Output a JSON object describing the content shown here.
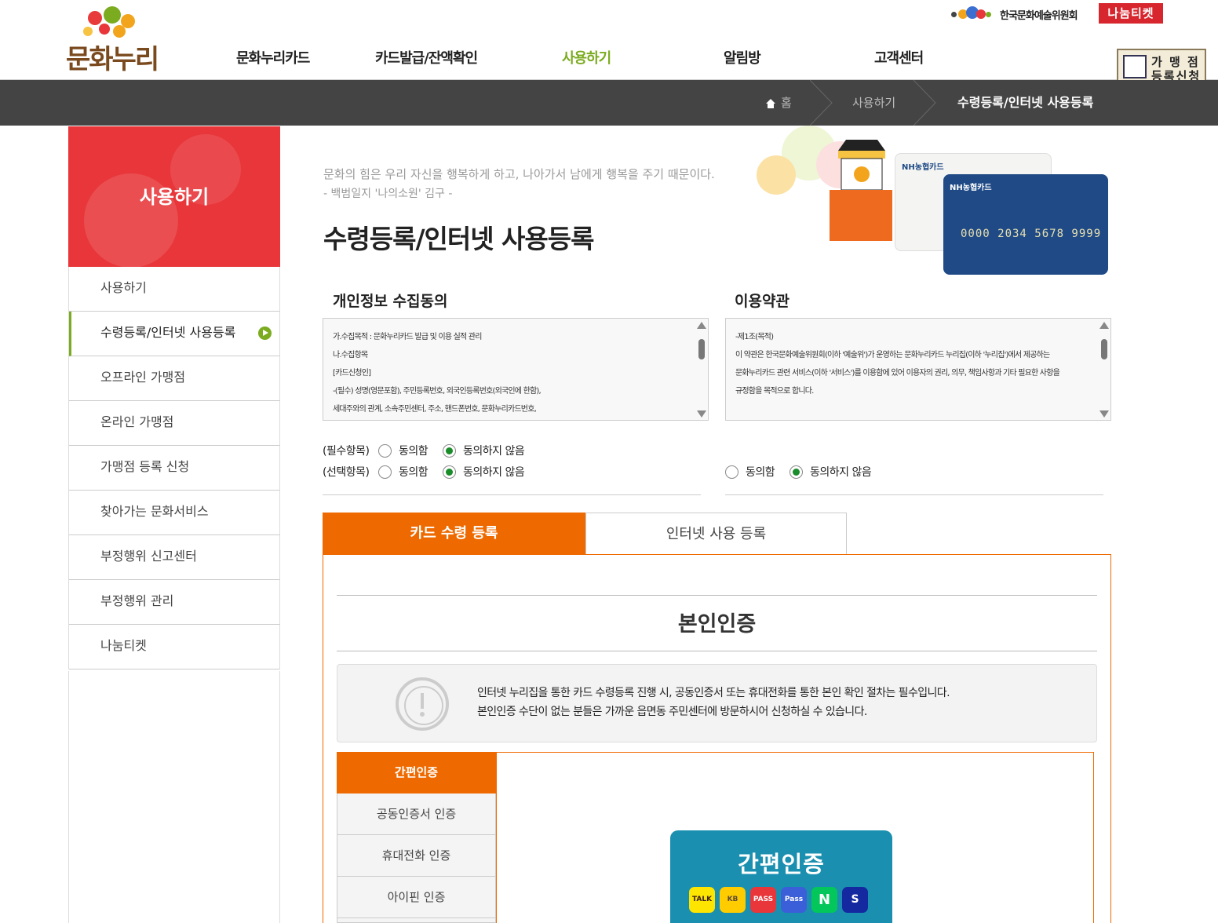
{
  "header": {
    "logo_text": "문화누리",
    "org_name": "한국문화예술위원회",
    "nanum_badge": "나눔티켓",
    "store_apply_line1": "가 맹 점",
    "store_apply_line2": "등록신청",
    "gnb": [
      "문화누리카드",
      "카드발급/잔액확인",
      "사용하기",
      "알림방",
      "고객센터"
    ],
    "gnb_active": "사용하기"
  },
  "breadcrumb": {
    "home": "홈",
    "level1": "사용하기",
    "current": "수령등록/인터넷 사용등록"
  },
  "sidebar": {
    "title": "사용하기",
    "items": [
      {
        "label": "사용하기"
      },
      {
        "label": "수령등록/인터넷 사용등록",
        "active": true
      },
      {
        "label": "오프라인 가맹점"
      },
      {
        "label": "온라인 가맹점"
      },
      {
        "label": "가맹점 등록 신청"
      },
      {
        "label": "찾아가는 문화서비스"
      },
      {
        "label": "부정행위 신고센터"
      },
      {
        "label": "부정행위 관리"
      },
      {
        "label": "나눔티켓"
      }
    ]
  },
  "main": {
    "quote": "문화의 힘은 우리 자신을 행복하게 하고, 나아가서 남에게 행복을 주기 때문이다.",
    "quote_source": "- 백범일지 '나의소원' 김구 -",
    "page_title": "수령등록/인터넷 사용등록",
    "hero_card": {
      "brand": "NH농협카드",
      "number": "0000 2034 5678 9999"
    },
    "privacy": {
      "title": "개인정보 수집동의",
      "lines": [
        "가.수집목적 : 문화누리카드 발급 및 이용 실적 관리",
        "나.수집항목",
        "[카드신청인]",
        "-(필수) 성명(영문포함), 주민등록번호, 외국인등록번호(외국인에 한함),",
        "세대주와의 관계, 소속주민센터, 주소, 핸드폰번호, 문화누리카드번호,"
      ],
      "required_label": "(필수항목)",
      "optional_label": "(선택항목)",
      "agree": "동의함",
      "disagree": "동의하지 않음"
    },
    "terms": {
      "title": "이용약관",
      "lines": [
        "-제1조(목적)",
        "이 약관은 한국문화예술위원회(이하 '예술위')가 운영하는 문화누리카드 누리집(이하 '누리집')에서 제공하는",
        "문화누리카드 관련 서비스(이하 '서비스')를 이용함에 있어 이용자의 권리, 의무, 책임사항과 기타 필요한 사항을",
        "규정함을 목적으로 합니다."
      ],
      "agree": "동의함",
      "disagree": "동의하지 않음"
    },
    "tabs": [
      {
        "label": "카드 수령 등록",
        "active": true
      },
      {
        "label": "인터넷 사용 등록",
        "active": false
      }
    ],
    "auth": {
      "title": "본인인증",
      "notice_line1": "인터넷 누리집을 통한 카드 수령등록 진행 시, 공동인증서 또는 휴대전화를 통한 본인 확인 절차는 필수입니다.",
      "notice_line2": "본인인증 수단이 없는 분들은 가까운 읍면동 주민센터에 방문하시어 신청하실 수 있습니다.",
      "methods": [
        {
          "label": "간편인증",
          "active": true
        },
        {
          "label": "공동인증서 인증"
        },
        {
          "label": "휴대전화 인증"
        },
        {
          "label": "아이핀 인증"
        }
      ],
      "easy_button": "간편인증",
      "apps": [
        "TALK",
        "KB",
        "PASS",
        "Pass",
        "N",
        "S"
      ]
    }
  }
}
